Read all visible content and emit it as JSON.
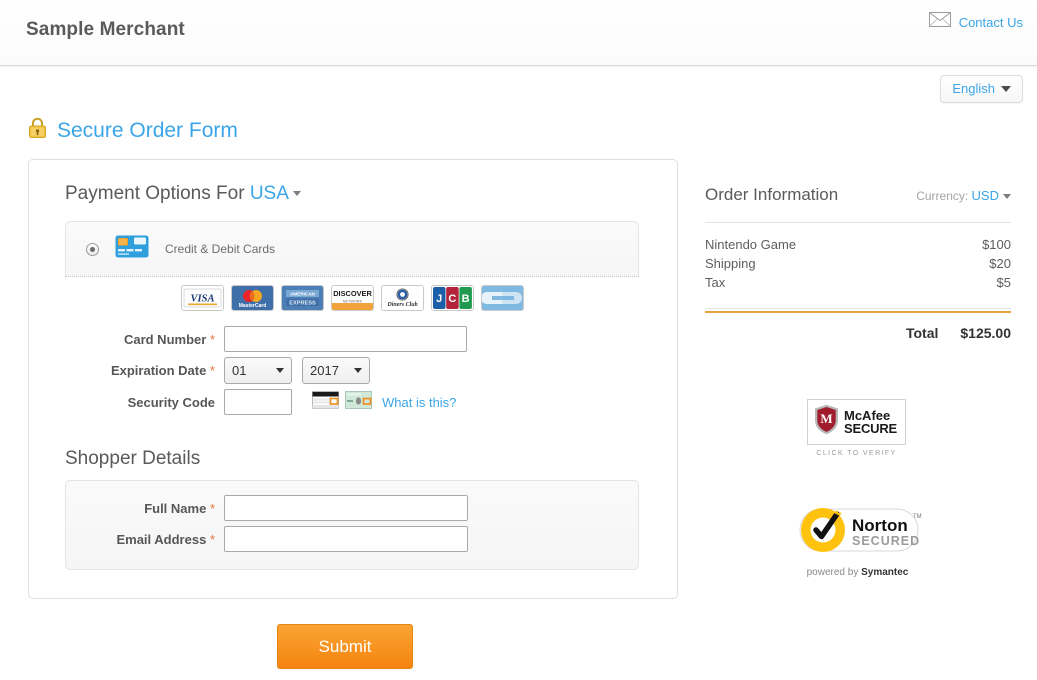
{
  "header": {
    "merchant_name": "Sample Merchant",
    "contact_label": "Contact Us",
    "envelope_icon": "envelope-icon"
  },
  "language": {
    "selected": "English"
  },
  "secure": {
    "title": "Secure Order Form",
    "lock_icon": "lock-icon"
  },
  "payment_options": {
    "heading_prefix": "Payment Options For",
    "country": "USA",
    "method": {
      "label": "Credit & Debit Cards",
      "icon": "credit-card-icon",
      "selected": true
    },
    "card_brands": [
      {
        "name": "visa",
        "label": "VISA"
      },
      {
        "name": "mastercard",
        "label": "MasterCard"
      },
      {
        "name": "amex",
        "label": "AMERICAN EXPRESS"
      },
      {
        "name": "discover",
        "label": "DISCOVER"
      },
      {
        "name": "diners-club",
        "label": "Diners Club"
      },
      {
        "name": "jcb",
        "label": "JCB"
      },
      {
        "name": "cb",
        "label": "CB"
      }
    ]
  },
  "card_form": {
    "card_number": {
      "label": "Card Number",
      "required_mark": "*",
      "value": "",
      "placeholder": ""
    },
    "expiration": {
      "label": "Expiration Date",
      "required_mark": "*",
      "month": "01",
      "year": "2017"
    },
    "security_code": {
      "label": "Security Code",
      "value": "",
      "placeholder": "",
      "help_link": "What is this?",
      "icon_back": "card-back-cvv-icon",
      "icon_front": "card-front-cvv-icon"
    }
  },
  "shopper": {
    "heading": "Shopper Details",
    "full_name": {
      "label": "Full Name",
      "required_mark": "*",
      "value": "",
      "placeholder": ""
    },
    "email": {
      "label": "Email Address",
      "required_mark": "*",
      "value": "",
      "placeholder": ""
    }
  },
  "submit": {
    "label": "Submit"
  },
  "order": {
    "title": "Order Information",
    "currency_label": "Currency:",
    "currency_value": "USD",
    "items": [
      {
        "name": "Nintendo Game",
        "price": "$100"
      },
      {
        "name": "Shipping",
        "price": "$20"
      },
      {
        "name": "Tax",
        "price": "$5"
      }
    ],
    "total_label": "Total",
    "total_value": "$125.00"
  },
  "badges": {
    "mcafee": {
      "line1": "McAfee",
      "line2": "SECURE",
      "verify": "CLICK TO VERIFY",
      "icon": "mcafee-shield-icon"
    },
    "norton": {
      "line1": "Norton",
      "line2": "SECURED",
      "powered_prefix": "powered by",
      "powered_brand": "Symantec",
      "icon": "norton-check-icon"
    }
  },
  "colors": {
    "link_blue": "#3aa5e8",
    "accent_orange": "#f58410",
    "required_orange": "#e8763a",
    "text_gray": "#5a5a5a"
  }
}
